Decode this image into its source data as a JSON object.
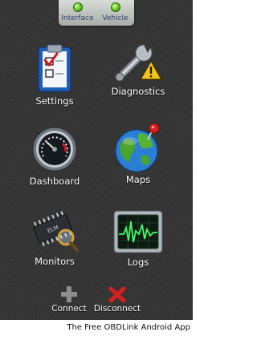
{
  "status": {
    "interface_label": "Interface",
    "vehicle_label": "Vehicle",
    "indicator_color": "#6ed21f"
  },
  "menu": {
    "settings": "Settings",
    "diagnostics": "Diagnostics",
    "dashboard": "Dashboard",
    "maps": "Maps",
    "monitors": "Monitors",
    "logs": "Logs"
  },
  "actions": {
    "connect": "Connect",
    "disconnect": "Disconnect"
  },
  "chip_text": "ELM",
  "caption": "The Free OBDLink Android App",
  "icons": {
    "settings": "clipboard-checklist-icon",
    "diagnostics": "wrench-warning-icon",
    "dashboard": "gauge-icon",
    "maps": "globe-pin-icon",
    "monitors": "chip-magnifier-icon",
    "logs": "oscilloscope-icon",
    "connect": "plus-icon",
    "disconnect": "x-icon"
  },
  "colors": {
    "background": "#363636",
    "label_text": "#ffffff",
    "status_text": "#2c3f78",
    "disconnect_red": "#d81e1e"
  }
}
